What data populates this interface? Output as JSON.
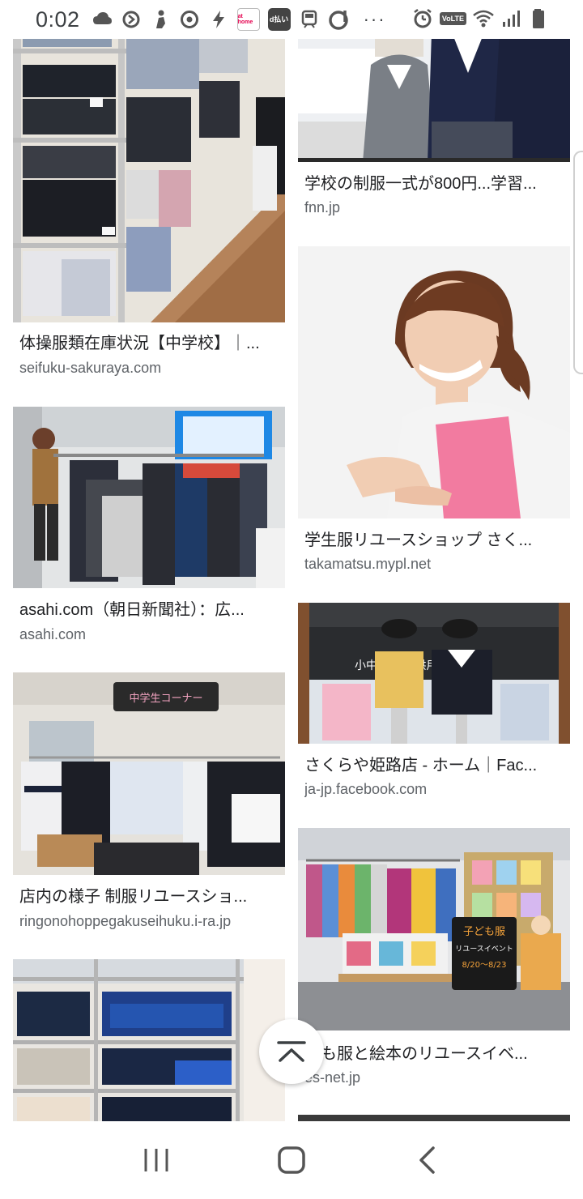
{
  "status_bar": {
    "time": "0:02",
    "home_badge": "at home",
    "dpay_badge": "d払い",
    "overflow": "···",
    "volte": "VoLTE"
  },
  "results": {
    "left": [
      {
        "title": "体操服類在庫状況【中学校】｜...",
        "domain": "seifuku-sakuraya.com",
        "image": "uniform-shelves-photo"
      },
      {
        "title": "asahi.com（朝日新聞社）：広...",
        "domain": "asahi.com",
        "image": "uniform-rack-photo"
      },
      {
        "title": "店内の様子 制服リユースショ...",
        "domain": "ringonohoppegakuseihuku.i-ra.jp",
        "image": "shop-interior-photo"
      },
      {
        "title": "",
        "domain": "",
        "image": "folded-uniforms-photo"
      }
    ],
    "right": [
      {
        "title": "学校の制服一式が800円...学習...",
        "domain": "fnn.jp",
        "image": "mannequins-photo"
      },
      {
        "title": "学生服リユースショップ さく...",
        "domain": "takamatsu.mypl.net",
        "image": "woman-apron-photo"
      },
      {
        "title": "さくらや姫路店 - ホーム｜Fac...",
        "domain": "ja-jp.facebook.com",
        "image": "storefront-photo"
      },
      {
        "title": "ども服と絵本のリユースイベ...",
        "domain": "es-net.jp",
        "image": "kids-clothes-event-photo"
      }
    ]
  },
  "photo_text": {
    "storefront_sign": "小中高校 子供用",
    "event_sign_line1": "子ども服",
    "event_sign_line2": "リユースイベント",
    "event_sign_line3": "8/20〜8/23",
    "shop_sign": "中学生コーナー"
  },
  "fab": {
    "icon": "scroll-to-top-icon"
  },
  "nav_bar": {
    "icons": [
      "recent-apps-icon",
      "home-icon",
      "back-icon"
    ]
  },
  "colors": {
    "title": "#202124",
    "domain": "#5f6368",
    "background": "#ffffff"
  }
}
